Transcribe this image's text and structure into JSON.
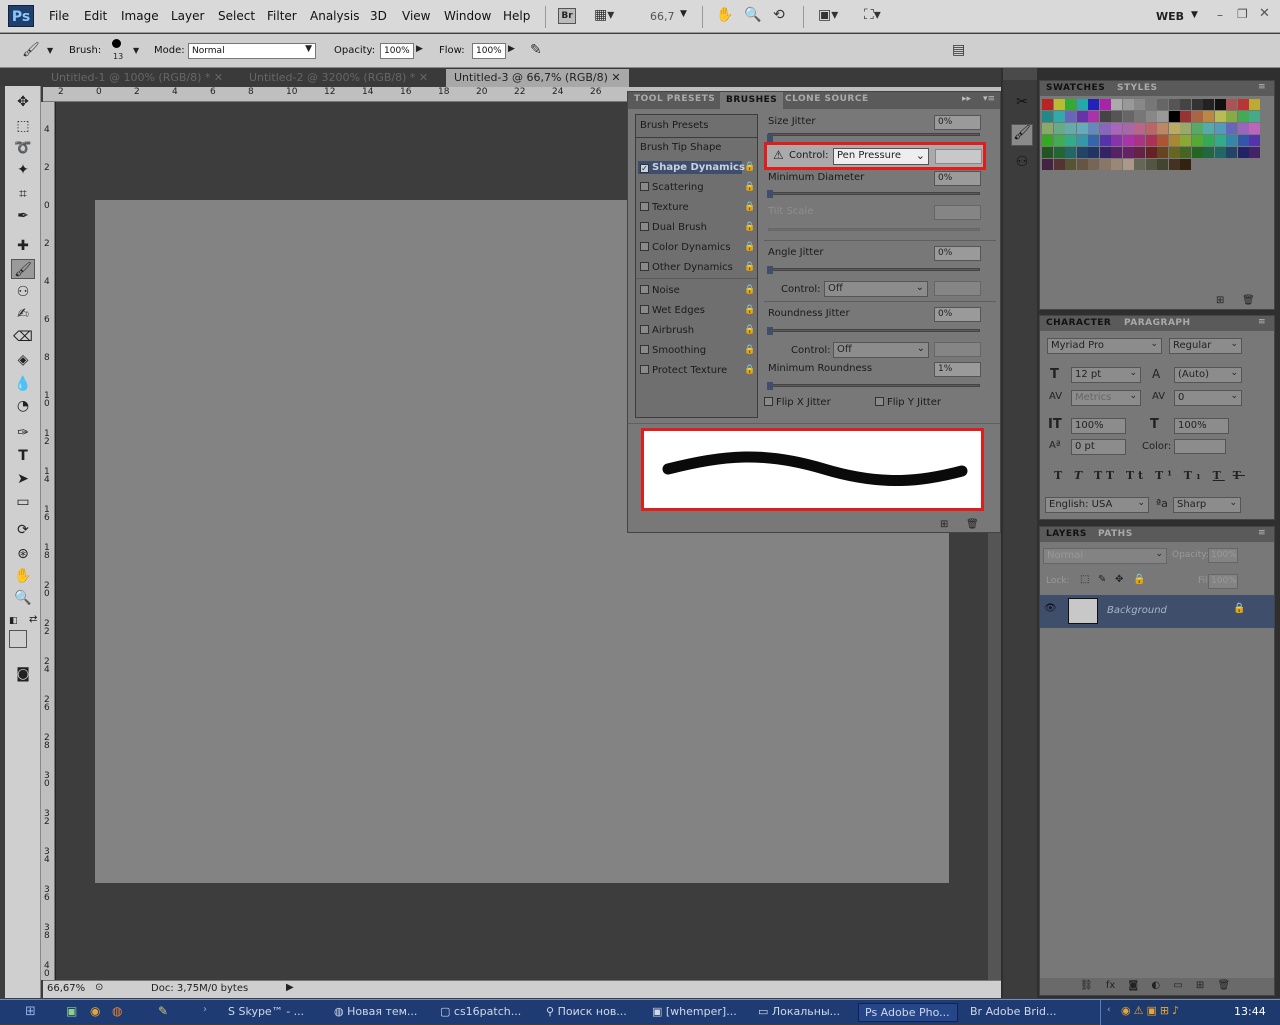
{
  "app": {
    "logo": "Ps"
  },
  "menu": [
    "File",
    "Edit",
    "Image",
    "Layer",
    "Select",
    "Filter",
    "Analysis",
    "3D",
    "View",
    "Window",
    "Help"
  ],
  "appbar": {
    "bridge_label": "Br",
    "zoom": "66,7",
    "workspace": "WEB"
  },
  "options": {
    "brush_label": "Brush:",
    "brush_size": "13",
    "mode_label": "Mode:",
    "mode_value": "Normal",
    "opacity_label": "Opacity:",
    "opacity_value": "100%",
    "flow_label": "Flow:",
    "flow_value": "100%"
  },
  "tabs": [
    {
      "label": "Untitled-1 @ 100% (RGB/8) *"
    },
    {
      "label": "Untitled-2 @ 3200% (RGB/8) *"
    },
    {
      "label": "Untitled-3 @ 66,7% (RGB/8)"
    }
  ],
  "hruler": [
    "2",
    "0",
    "2",
    "4",
    "6",
    "8",
    "10",
    "12",
    "14",
    "16",
    "18",
    "20",
    "22",
    "24",
    "26"
  ],
  "vruler": [
    "4",
    "2",
    "0",
    "2",
    "4",
    "6",
    "8",
    "1\n0",
    "1\n2",
    "1\n4",
    "1\n6",
    "1\n8",
    "2\n0",
    "2\n2",
    "2\n4",
    "2\n6",
    "2\n8",
    "3\n0",
    "3\n2",
    "3\n4",
    "3\n6",
    "3\n8",
    "4\n0"
  ],
  "status": {
    "zoom": "66,67%",
    "doc": "Doc: 3,75M/0 bytes"
  },
  "brushes_panel": {
    "tabs": [
      "TOOL PRESETS",
      "BRUSHES",
      "CLONE SOURCE"
    ],
    "left_items": [
      "Brush Presets",
      "Brush Tip Shape",
      "Shape Dynamics",
      "Scattering",
      "Texture",
      "Dual Brush",
      "Color Dynamics",
      "Other Dynamics",
      "Noise",
      "Wet Edges",
      "Airbrush",
      "Smoothing",
      "Protect Texture"
    ],
    "size_jitter": {
      "label": "Size Jitter",
      "value": "0%"
    },
    "control1": {
      "label": "Control:",
      "value": "Pen Pressure"
    },
    "min_diameter": {
      "label": "Minimum Diameter",
      "value": "0%"
    },
    "tilt_scale": {
      "label": "Tilt Scale"
    },
    "angle_jitter": {
      "label": "Angle Jitter",
      "value": "0%"
    },
    "control2": {
      "label": "Control:",
      "value": "Off"
    },
    "roundness_jitter": {
      "label": "Roundness Jitter",
      "value": "0%"
    },
    "control3": {
      "label": "Control:",
      "value": "Off"
    },
    "min_roundness": {
      "label": "Minimum Roundness",
      "value": "1%"
    },
    "flip_x": "Flip X Jitter",
    "flip_y": "Flip Y Jitter"
  },
  "swatches_panel": {
    "tabs": [
      "SWATCHES",
      "STYLES"
    ]
  },
  "character_panel": {
    "tabs": [
      "CHARACTER",
      "PARAGRAPH"
    ],
    "font": "Myriad Pro",
    "style": "Regular",
    "size": "12 pt",
    "leading": "(Auto)",
    "kerning": "Metrics",
    "tracking": "0",
    "vscale": "100%",
    "hscale": "100%",
    "baseline": "0 pt",
    "color_label": "Color:",
    "language": "English: USA",
    "aa": "Sharp"
  },
  "layers_panel": {
    "tabs": [
      "LAYERS",
      "PATHS"
    ],
    "blend": "Normal",
    "opacity_label": "Opacity:",
    "opacity": "100%",
    "lock_label": "Lock:",
    "fill_label": "Fill:",
    "fill": "100%",
    "layer_name": "Background"
  },
  "taskbar": {
    "items": [
      "Skype™ - ...",
      "Новая тем...",
      "cs16patch...",
      "Поиск нов...",
      "[whemper]...",
      "Локальны...",
      "Adobe Pho...",
      "Adobe Brid..."
    ],
    "clock": "13:44"
  },
  "colors": {
    "highlight": "#e01d1d",
    "selected_item": "#3e4e6b",
    "taskbar": "#1e3c73"
  }
}
